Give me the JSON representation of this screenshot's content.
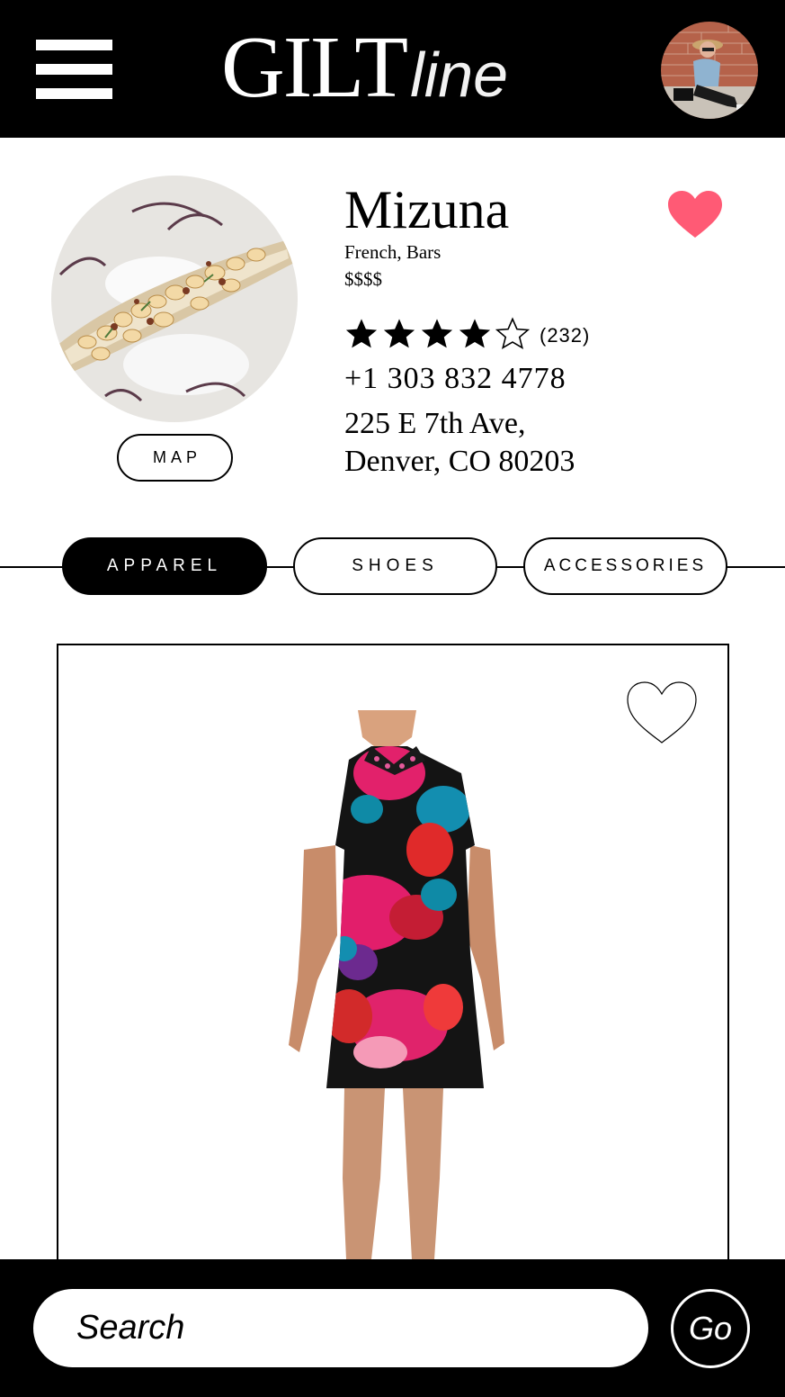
{
  "header": {
    "logo_main": "GILT",
    "logo_sub": "line",
    "menu_icon": "hamburger-menu-icon",
    "avatar": "user-avatar-photo"
  },
  "restaurant": {
    "name": "Mizuna",
    "cuisine": "French, Bars",
    "price": "$$$$",
    "rating": 4,
    "rating_max": 5,
    "reviews": "(232)",
    "phone": "+1 303 832 4778",
    "address_line1": "225 E 7th Ave,",
    "address_line2": "Denver, CO 80203",
    "map_label": "MAP",
    "favorite": true,
    "heart_color": "#ff5a75"
  },
  "tabs": [
    {
      "label": "APPAREL",
      "active": true
    },
    {
      "label": "SHOES",
      "active": false
    },
    {
      "label": "ACCESSORIES",
      "active": false
    }
  ],
  "product": {
    "favorite": false,
    "image": "floral-print-collared-dress"
  },
  "search": {
    "placeholder": "Search",
    "go_label": "Go"
  }
}
